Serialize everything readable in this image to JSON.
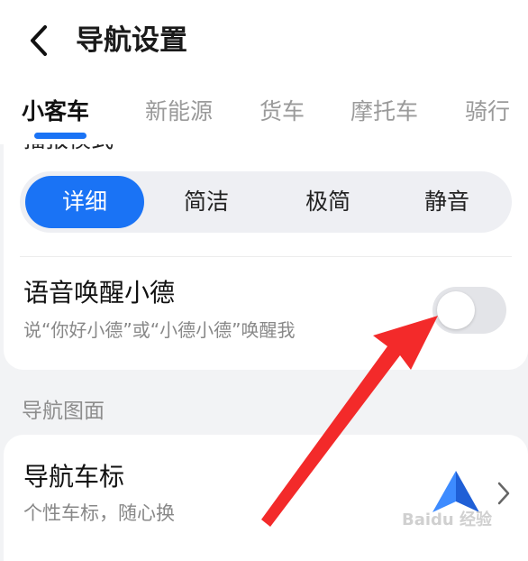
{
  "header": {
    "title": "导航设置",
    "back_icon": "chevron-left-icon"
  },
  "tabs": [
    {
      "label": "小客车",
      "active": true
    },
    {
      "label": "新能源",
      "active": false
    },
    {
      "label": "货车",
      "active": false
    },
    {
      "label": "摩托车",
      "active": false
    },
    {
      "label": "骑行",
      "active": false
    }
  ],
  "colors": {
    "accent": "#1a73f5",
    "annotation_arrow": "#f32a2a",
    "background": "#f2f3f5"
  },
  "broadcast": {
    "heading_partial": "播报模式",
    "modes": [
      {
        "label": "详细",
        "selected": true
      },
      {
        "label": "简洁",
        "selected": false
      },
      {
        "label": "极简",
        "selected": false
      },
      {
        "label": "静音",
        "selected": false
      }
    ]
  },
  "voice_wake": {
    "title": "语音唤醒小德",
    "description": "说“你好小德”或“小德小德”唤醒我",
    "toggle_on": false
  },
  "section_nav_view": {
    "label": "导航图面"
  },
  "car_icon_setting": {
    "title": "导航车标",
    "description": "个性车标，随心换",
    "icon": "navigation-arrow-icon",
    "chevron": "chevron-right-icon"
  },
  "watermark": {
    "text": "Baidu 经验"
  }
}
